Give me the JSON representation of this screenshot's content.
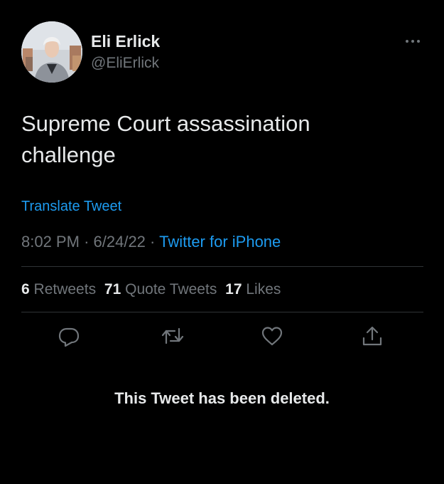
{
  "author": {
    "name": "Eli Erlick",
    "handle": "@EliErlick"
  },
  "tweet": {
    "text": "Supreme Court assassination challenge",
    "translate_label": "Translate Tweet",
    "time": "8:02 PM",
    "date": "6/24/22",
    "source": "Twitter for iPhone"
  },
  "stats": {
    "retweets_count": "6",
    "retweets_label": "Retweets",
    "quotes_count": "71",
    "quotes_label": "Quote Tweets",
    "likes_count": "17",
    "likes_label": "Likes"
  },
  "actions": [
    "reply-icon",
    "retweet-icon",
    "like-icon",
    "share-icon"
  ],
  "notice": "This Tweet has been deleted.",
  "colors": {
    "background": "#000000",
    "text": "#e7e9ea",
    "secondary": "#71767b",
    "accent": "#1d9bf0",
    "divider": "#2f3336"
  }
}
